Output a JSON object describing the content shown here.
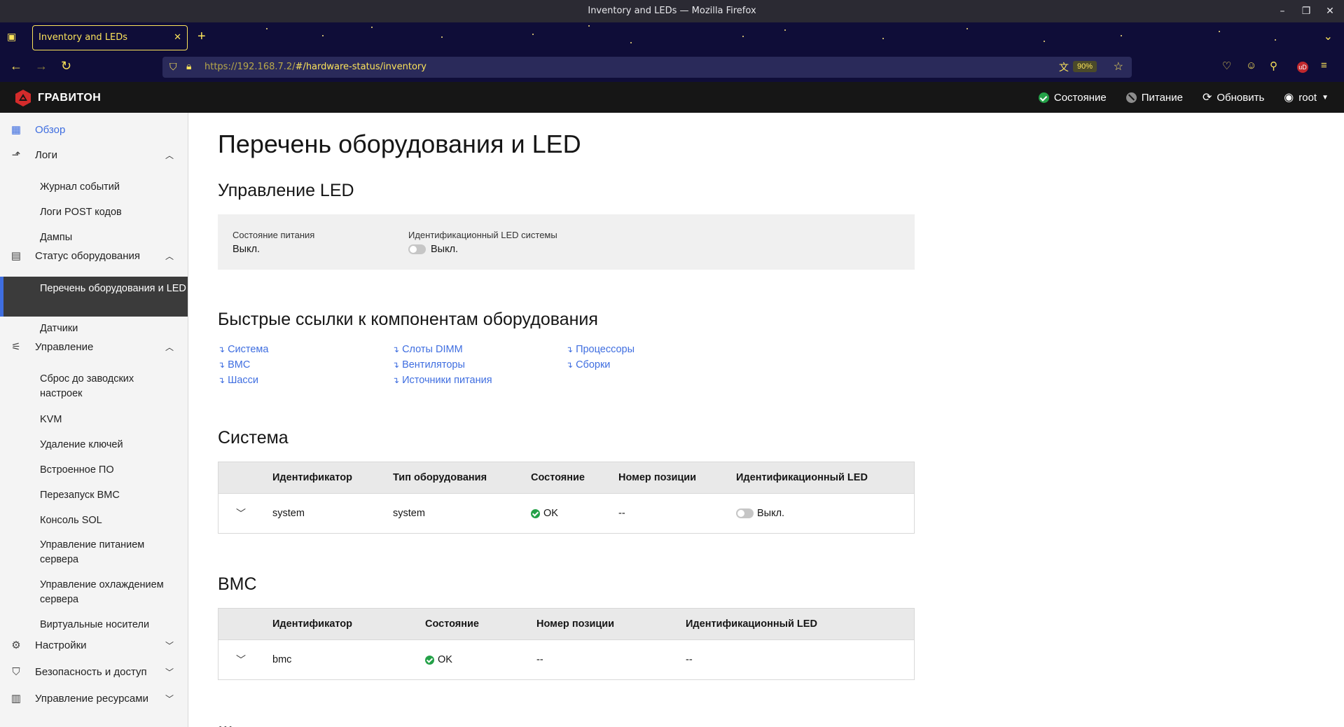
{
  "window": {
    "title": "Inventory and LEDs — Mozilla Firefox",
    "controls": [
      "–",
      "❐",
      "✕"
    ]
  },
  "browser": {
    "tab_title": "Inventory and LEDs",
    "tab_close": "✕",
    "new_tab": "+",
    "url_host": "https://192.168.7.2/",
    "url_path": "#/hardware-status/inventory",
    "zoom": "90%",
    "extensions": [
      "pocket-icon",
      "account-icon",
      "extensions-icon",
      "ublock-icon",
      "menu-icon"
    ],
    "ublock_label": "uD"
  },
  "app": {
    "brand": "ГРАВИТОН",
    "header": {
      "status": "Состояние",
      "power": "Питание",
      "refresh": "Обновить",
      "user": "root"
    }
  },
  "sidebar": {
    "overview": "Обзор",
    "logs": {
      "label": "Логи",
      "items": [
        "Журнал событий",
        "Логи POST кодов",
        "Дампы"
      ]
    },
    "hardware": {
      "label": "Статус оборудования",
      "items": [
        "Перечень оборудования и LED",
        "Датчики"
      ]
    },
    "control": {
      "label": "Управление",
      "items": [
        "Сброс до заводских настроек",
        "KVM",
        "Удаление ключей",
        "Встроенное ПО",
        "Перезапуск BMC",
        "Консоль SOL",
        "Управление питанием сервера",
        "Управление охлаждением сервера",
        "Виртуальные носители"
      ]
    },
    "settings": "Настройки",
    "security": "Безопасность и доступ",
    "resources": "Управление ресурсами"
  },
  "page": {
    "title": "Перечень оборудования и LED",
    "led_section": {
      "title": "Управление LED",
      "power_state_label": "Состояние питания",
      "power_state_value": "Выкл.",
      "system_led_label": "Идентификационный LED системы",
      "system_led_value": "Выкл."
    },
    "quick_links": {
      "title": "Быстрые ссылки к компонентам оборудования",
      "arrow": "↴",
      "links": [
        "Система",
        "BMC",
        "Шасси",
        "Слоты DIMM",
        "Вентиляторы",
        "Источники питания",
        "Процессоры",
        "Сборки"
      ]
    },
    "system": {
      "title": "Система",
      "headers": [
        "Идентификатор",
        "Тип оборудования",
        "Состояние",
        "Номер позиции",
        "Идентификационный LED"
      ],
      "row": {
        "id": "system",
        "type": "system",
        "status": "OK",
        "part": "--",
        "led": "Выкл."
      }
    },
    "bmc": {
      "title": "BMC",
      "headers": [
        "Идентификатор",
        "Состояние",
        "Номер позиции",
        "Идентификационный LED"
      ],
      "row": {
        "id": "bmc",
        "status": "OK",
        "part": "--",
        "led": "--"
      }
    },
    "more": "..."
  },
  "colors": {
    "accent": "#3f6ee0",
    "ok": "#24a148",
    "header_bg": "#161616",
    "browser_accent": "#fbe35a"
  }
}
